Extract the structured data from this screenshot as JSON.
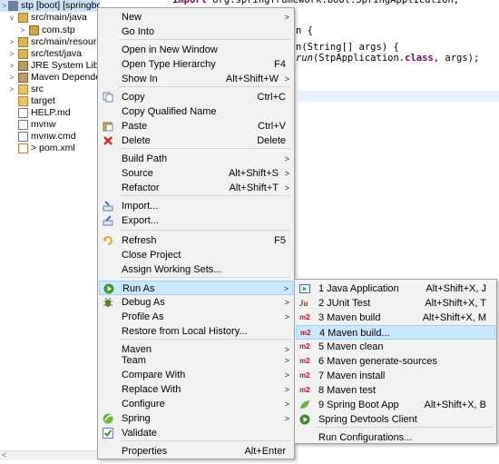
{
  "tree": {
    "items": [
      {
        "label": "stp [boot] [springbootwebst master]",
        "icon": "project-icon"
      },
      {
        "label": "src/main/java",
        "icon": "source-folder-icon"
      },
      {
        "label": "com.stp",
        "icon": "package-icon"
      },
      {
        "label": "src/main/resources",
        "icon": "source-folder-icon"
      },
      {
        "label": "src/test/java",
        "icon": "source-folder-icon"
      },
      {
        "label": "JRE System Library",
        "icon": "library-icon"
      },
      {
        "label": "Maven Dependencies",
        "icon": "library-icon"
      },
      {
        "label": "src",
        "icon": "folder-icon"
      },
      {
        "label": "target",
        "icon": "folder-icon"
      },
      {
        "label": "HELP.md",
        "icon": "file-icon"
      },
      {
        "label": "mvnw",
        "icon": "file-icon"
      },
      {
        "label": "mvnw.cmd",
        "icon": "file-icon"
      },
      {
        "label": "> pom.xml",
        "icon": "xml-file-icon"
      }
    ]
  },
  "editor": {
    "line_import": "import org.springframework.boot.SpringApplication;",
    "import_kw": "import",
    "line_class": "n {",
    "line_main": "n(String[] args) {",
    "line_run_a": "run",
    "line_run_b": "(StpApplication.",
    "line_run_kw": "class",
    "line_run_c": ", args);"
  },
  "context_menu": {
    "items": [
      {
        "label": "New",
        "shortcut": "",
        "submenu": true
      },
      {
        "label": "Go Into",
        "shortcut": ""
      },
      {
        "label": "Open in New Window",
        "shortcut": ""
      },
      {
        "label": "Open Type Hierarchy",
        "shortcut": "F4"
      },
      {
        "label": "Show In",
        "shortcut": "Alt+Shift+W",
        "submenu": true
      },
      {
        "label": "Copy",
        "shortcut": "Ctrl+C"
      },
      {
        "label": "Copy Qualified Name",
        "shortcut": ""
      },
      {
        "label": "Paste",
        "shortcut": "Ctrl+V"
      },
      {
        "label": "Delete",
        "shortcut": "Delete"
      },
      {
        "label": "Build Path",
        "shortcut": "",
        "submenu": true
      },
      {
        "label": "Source",
        "shortcut": "Alt+Shift+S",
        "submenu": true
      },
      {
        "label": "Refactor",
        "shortcut": "Alt+Shift+T",
        "submenu": true
      },
      {
        "label": "Import...",
        "shortcut": ""
      },
      {
        "label": "Export...",
        "shortcut": ""
      },
      {
        "label": "Refresh",
        "shortcut": "F5"
      },
      {
        "label": "Close Project",
        "shortcut": ""
      },
      {
        "label": "Assign Working Sets...",
        "shortcut": ""
      },
      {
        "label": "Run As",
        "shortcut": "",
        "submenu": true
      },
      {
        "label": "Debug As",
        "shortcut": "",
        "submenu": true
      },
      {
        "label": "Profile As",
        "shortcut": "",
        "submenu": true
      },
      {
        "label": "Restore from Local History...",
        "shortcut": ""
      },
      {
        "label": "Maven",
        "shortcut": "",
        "submenu": true
      },
      {
        "label": "Team",
        "shortcut": "",
        "submenu": true
      },
      {
        "label": "Compare With",
        "shortcut": "",
        "submenu": true
      },
      {
        "label": "Replace With",
        "shortcut": "",
        "submenu": true
      },
      {
        "label": "Configure",
        "shortcut": "",
        "submenu": true
      },
      {
        "label": "Spring",
        "shortcut": "",
        "submenu": true
      },
      {
        "label": "Validate",
        "shortcut": ""
      },
      {
        "label": "Properties",
        "shortcut": "Alt+Enter"
      }
    ]
  },
  "run_as_menu": {
    "items": [
      {
        "label": "1 Java Application",
        "shortcut": "Alt+Shift+X, J",
        "icon_text": ""
      },
      {
        "label": "2 JUnit Test",
        "shortcut": "Alt+Shift+X, T",
        "icon_text": "Ju"
      },
      {
        "label": "3 Maven build",
        "shortcut": "Alt+Shift+X, M",
        "icon_text": "m2"
      },
      {
        "label": "4 Maven build...",
        "shortcut": "",
        "icon_text": "m2"
      },
      {
        "label": "5 Maven clean",
        "shortcut": "",
        "icon_text": "m2"
      },
      {
        "label": "6 Maven generate-sources",
        "shortcut": "",
        "icon_text": "m2"
      },
      {
        "label": "7 Maven install",
        "shortcut": "",
        "icon_text": "m2"
      },
      {
        "label": "8 Maven test",
        "shortcut": "",
        "icon_text": "m2"
      },
      {
        "label": "9 Spring Boot App",
        "shortcut": "Alt+Shift+X, B",
        "icon_text": ""
      },
      {
        "label": "Spring Devtools Client",
        "shortcut": "",
        "icon_text": ""
      },
      {
        "label": "Run Configurations...",
        "shortcut": "",
        "icon_text": ""
      }
    ]
  },
  "arrow_glyph": ">",
  "colors": {
    "highlight_bg": "#cce8ff",
    "highlight_border": "#99d1ff",
    "menu_bg": "#f2f2f2",
    "m2_red": "#c0102a",
    "keyword": "#7f0055"
  }
}
